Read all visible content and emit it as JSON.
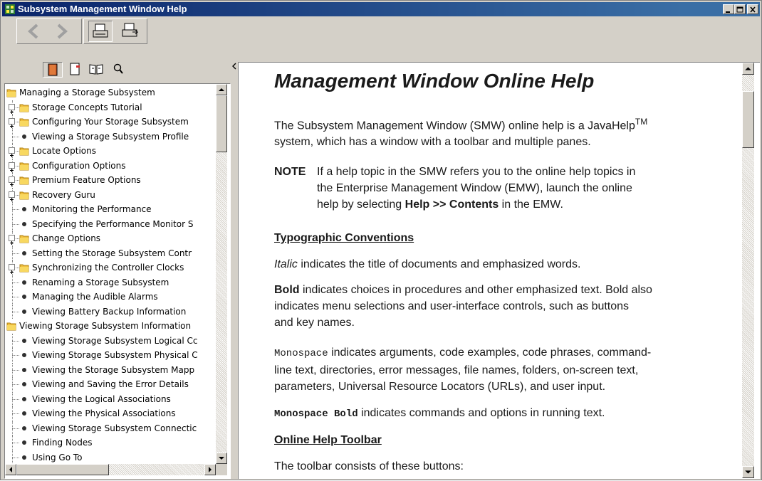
{
  "window": {
    "title": "Subsystem Management Window Help"
  },
  "toolbar": {
    "buttons": [
      {
        "name": "back",
        "icon": "back-arrow-icon"
      },
      {
        "name": "forward",
        "icon": "forward-arrow-icon"
      },
      {
        "name": "print",
        "icon": "printer-icon"
      },
      {
        "name": "page-setup",
        "icon": "page-setup-icon"
      }
    ]
  },
  "nav_tabs": [
    {
      "name": "contents",
      "icon": "book-icon"
    },
    {
      "name": "index",
      "icon": "index-icon"
    },
    {
      "name": "glossary",
      "icon": "glossary-book-icon"
    },
    {
      "name": "search",
      "icon": "search-icon"
    }
  ],
  "tree": [
    {
      "label": "Managing a Storage Subsystem",
      "type": "folder",
      "level": 0,
      "expander": false
    },
    {
      "label": "Storage Concepts Tutorial",
      "type": "folder",
      "level": 1,
      "expander": true
    },
    {
      "label": "Configuring Your Storage Subsystem",
      "type": "folder",
      "level": 1,
      "expander": true
    },
    {
      "label": "Viewing a Storage Subsystem Profile",
      "type": "topic",
      "level": 1,
      "expander": false
    },
    {
      "label": "Locate Options",
      "type": "folder",
      "level": 1,
      "expander": true
    },
    {
      "label": "Configuration Options",
      "type": "folder",
      "level": 1,
      "expander": true
    },
    {
      "label": "Premium Feature Options",
      "type": "folder",
      "level": 1,
      "expander": true
    },
    {
      "label": "Recovery Guru",
      "type": "folder",
      "level": 1,
      "expander": true
    },
    {
      "label": "Monitoring the Performance",
      "type": "topic",
      "level": 1,
      "expander": false
    },
    {
      "label": "Specifying the Performance Monitor S",
      "type": "topic",
      "level": 1,
      "expander": false
    },
    {
      "label": "Change Options",
      "type": "folder",
      "level": 1,
      "expander": true
    },
    {
      "label": "Setting the Storage Subsystem Contr",
      "type": "topic",
      "level": 1,
      "expander": false
    },
    {
      "label": "Synchronizing the Controller Clocks",
      "type": "folder",
      "level": 1,
      "expander": true
    },
    {
      "label": "Renaming a Storage Subsystem",
      "type": "topic",
      "level": 1,
      "expander": false
    },
    {
      "label": "Managing the Audible Alarms",
      "type": "topic",
      "level": 1,
      "expander": false
    },
    {
      "label": "Viewing Battery Backup Information",
      "type": "topic",
      "level": 1,
      "expander": false
    },
    {
      "label": "Viewing Storage Subsystem Information",
      "type": "folder",
      "level": 0,
      "expander": false
    },
    {
      "label": "Viewing Storage Subsystem Logical Cc",
      "type": "topic",
      "level": 1,
      "expander": false
    },
    {
      "label": "Viewing Storage Subsystem Physical C",
      "type": "topic",
      "level": 1,
      "expander": false
    },
    {
      "label": "Viewing the Storage Subsystem Mapp",
      "type": "topic",
      "level": 1,
      "expander": false
    },
    {
      "label": "Viewing and Saving the Error Details",
      "type": "topic",
      "level": 1,
      "expander": false
    },
    {
      "label": "Viewing the Logical Associations",
      "type": "topic",
      "level": 1,
      "expander": false
    },
    {
      "label": "Viewing the Physical Associations",
      "type": "topic",
      "level": 1,
      "expander": false
    },
    {
      "label": "Viewing Storage Subsystem Connectic",
      "type": "topic",
      "level": 1,
      "expander": false
    },
    {
      "label": "Finding Nodes",
      "type": "topic",
      "level": 1,
      "expander": false
    },
    {
      "label": "Using Go To",
      "type": "topic",
      "level": 1,
      "expander": false
    }
  ],
  "content": {
    "heading": "Management Window Online Help",
    "intro_1": "The Subsystem Management Window (SMW) online help is a JavaHelp",
    "intro_tm": "TM",
    "intro_2": "system, which has a window with a toolbar and multiple panes.",
    "note_label": "NOTE",
    "note_1": "If a help topic in the SMW refers you to the online help topics in",
    "note_2": "the Enterprise Management Window (EMW), launch the online",
    "note_3a": "help by selecting ",
    "note_3b": "Help >> Contents",
    "note_3c": " in the EMW.",
    "typo_heading": "Typographic Conventions",
    "italic_word": "Italic",
    "italic_text": " indicates the title of documents and emphasized words.",
    "bold_word": "Bold",
    "bold_text_1": " indicates choices in procedures and other emphasized text. Bold also",
    "bold_text_2": "indicates menu selections and user-interface controls, such as buttons",
    "bold_text_3": "and key names.",
    "mono_word": "Monospace",
    "mono_text_1": " indicates arguments, code examples, code phrases, command-",
    "mono_text_2": "line text, directories, error messages, file names, folders, on-screen text,",
    "mono_text_3": "parameters, Universal Resource Locators (URLs), and user input.",
    "monobold_word": "Monospace Bold",
    "monobold_text": " indicates commands and options in running text.",
    "toolbar_heading": "Online Help Toolbar",
    "toolbar_text": "The toolbar consists of these buttons:"
  }
}
